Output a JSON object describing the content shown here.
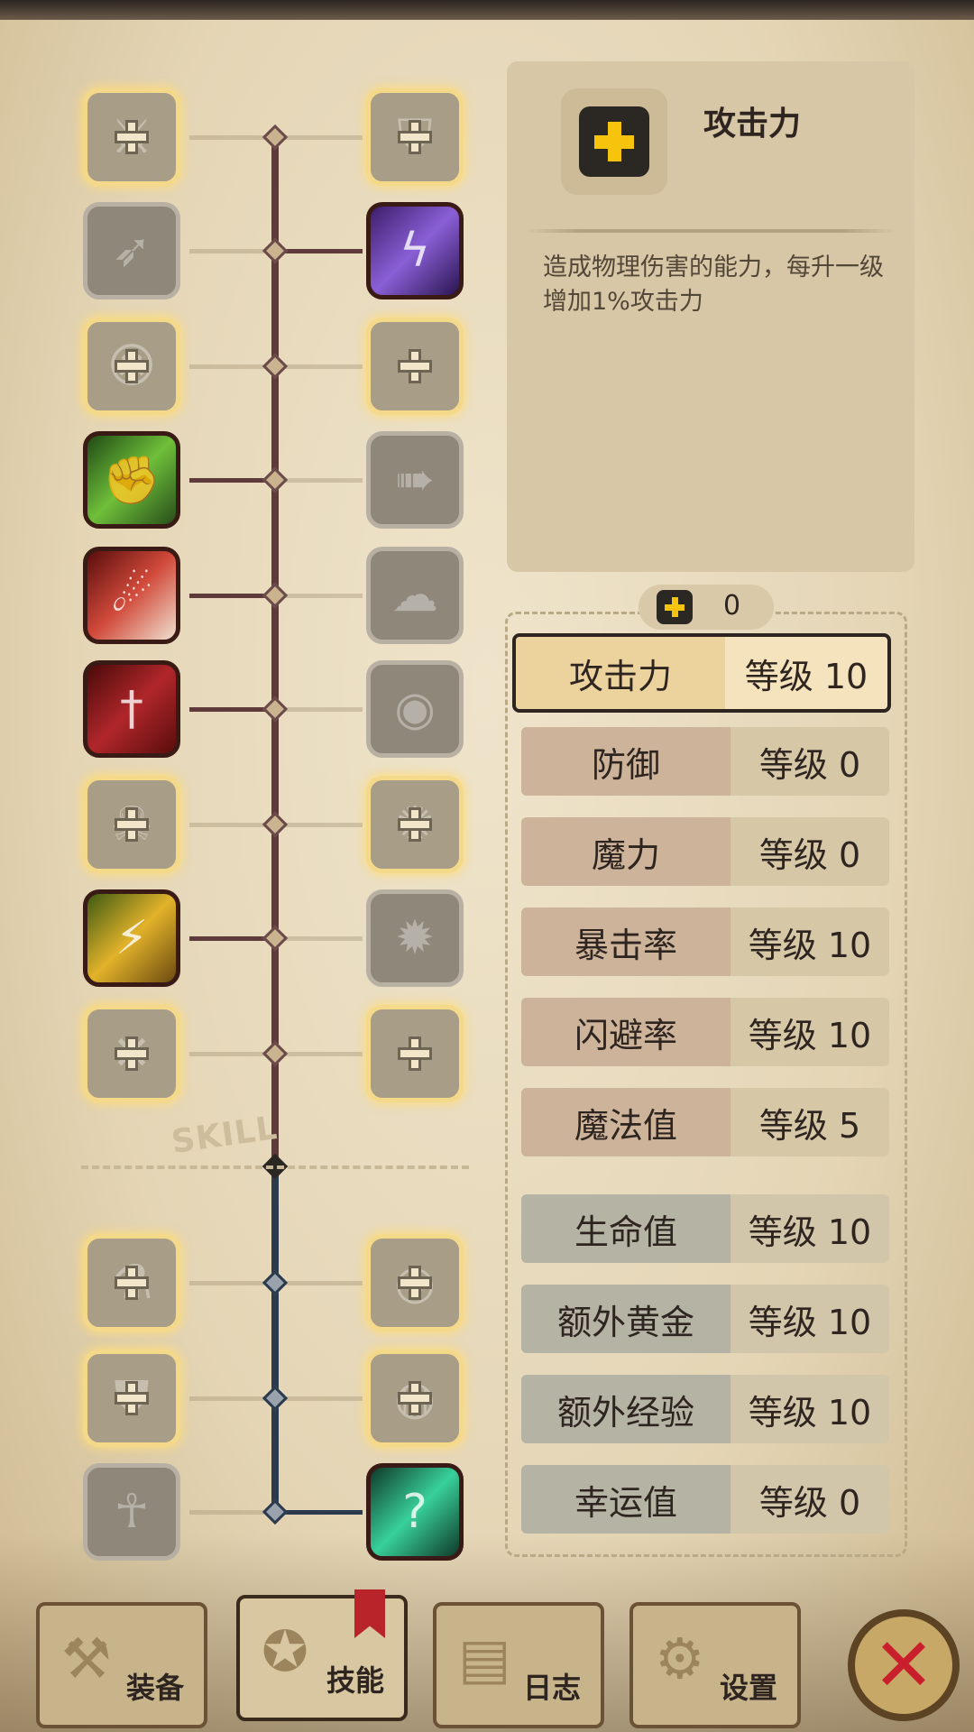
{
  "info": {
    "title": "攻击力",
    "description": "造成物理伤害的能力，每升一级增加1%攻击力"
  },
  "points": {
    "value": "0"
  },
  "stats": [
    {
      "name": "攻击力",
      "level": "等级 10",
      "group": "sel"
    },
    {
      "name": "防御",
      "level": "等级 0",
      "group": "red"
    },
    {
      "name": "魔力",
      "level": "等级 0",
      "group": "red"
    },
    {
      "name": "暴击率",
      "level": "等级 10",
      "group": "red"
    },
    {
      "name": "闪避率",
      "level": "等级 10",
      "group": "red"
    },
    {
      "name": "魔法值",
      "level": "等级 5",
      "group": "red"
    },
    {
      "name": "生命值",
      "level": "等级 10",
      "group": "blue"
    },
    {
      "name": "额外黄金",
      "level": "等级 10",
      "group": "blue"
    },
    {
      "name": "额外经验",
      "level": "等级 10",
      "group": "blue"
    },
    {
      "name": "幸运值",
      "level": "等级 0",
      "group": "blue"
    }
  ],
  "tree_label": "SKILL",
  "tabs": [
    {
      "label": "装备",
      "icon": "axe-icon"
    },
    {
      "label": "技能",
      "icon": "skill-icon"
    },
    {
      "label": "日志",
      "icon": "journal-icon"
    },
    {
      "label": "设置",
      "icon": "gear-icon"
    }
  ],
  "colors": {
    "accent_plus": "#f6c40d",
    "close": "#c91f2c",
    "upper_branch": "#5e3a3a",
    "lower_branch": "#2c3a4e"
  },
  "skills": [
    {
      "side": "left",
      "state": "locked",
      "icon": "sword-cross-icon"
    },
    {
      "side": "right",
      "state": "locked",
      "icon": "shield-icon"
    },
    {
      "side": "left",
      "state": "gray",
      "icon": "dash-strike-icon"
    },
    {
      "side": "right",
      "state": "owned",
      "icon": "purple-lightning-icon"
    },
    {
      "side": "left",
      "state": "locked",
      "icon": "rage-icon"
    },
    {
      "side": "right",
      "state": "locked",
      "icon": "shatter-icon"
    },
    {
      "side": "left",
      "state": "owned",
      "icon": "green-flex-icon"
    },
    {
      "side": "right",
      "state": "gray",
      "icon": "rush-icon"
    },
    {
      "side": "left",
      "state": "owned",
      "icon": "red-slash-icon"
    },
    {
      "side": "right",
      "state": "gray",
      "icon": "smoke-icon"
    },
    {
      "side": "left",
      "state": "owned",
      "icon": "red-dagger-icon"
    },
    {
      "side": "right",
      "state": "gray",
      "icon": "eye-burst-icon"
    },
    {
      "side": "left",
      "state": "locked",
      "icon": "ghost-icon"
    },
    {
      "side": "right",
      "state": "locked",
      "icon": "whirl-icon"
    },
    {
      "side": "left",
      "state": "owned",
      "icon": "gold-strike-icon"
    },
    {
      "side": "right",
      "state": "gray",
      "icon": "orb-icon"
    },
    {
      "side": "left",
      "state": "locked",
      "icon": "crossed-blades-icon"
    },
    {
      "side": "right",
      "state": "locked",
      "icon": "sparkle-icon"
    },
    {
      "side": "left",
      "state": "locked",
      "icon": "potion-icon"
    },
    {
      "side": "right",
      "state": "locked",
      "icon": "eye-icon"
    },
    {
      "side": "left",
      "state": "locked",
      "icon": "armor-icon"
    },
    {
      "side": "right",
      "state": "locked",
      "icon": "watch-eye-icon"
    },
    {
      "side": "left",
      "state": "gray",
      "icon": "aura-figure-icon"
    },
    {
      "side": "right",
      "state": "owned",
      "icon": "mystery-figure-icon"
    }
  ]
}
